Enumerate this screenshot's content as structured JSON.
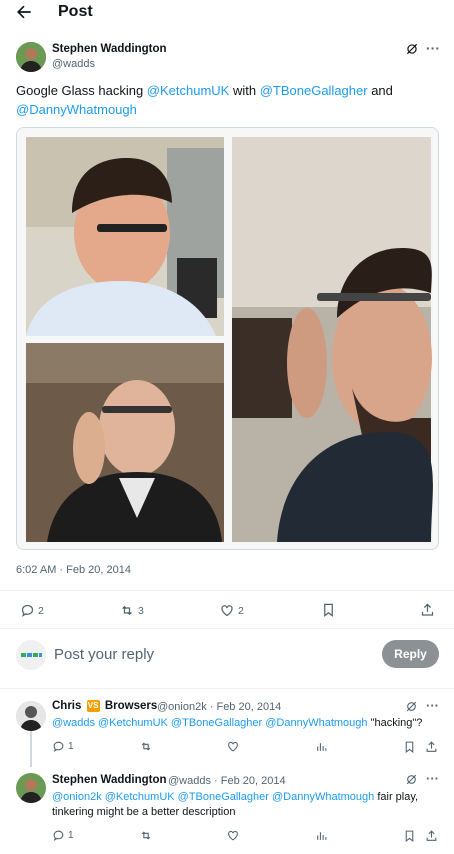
{
  "header": {
    "title": "Post",
    "back_icon": "arrow-left-icon"
  },
  "post": {
    "author_name": "Stephen Waddington",
    "author_handle": "@wadds",
    "text_before": "Google Glass hacking ",
    "mention_1": "@KetchumUK",
    "text_with": " with ",
    "mention_2": "@TBoneGallagher",
    "text_and": " and",
    "mention_3": "@DannyWhatmough",
    "timestamp": "6:02 AM · Feb 20, 2014",
    "replies": "2",
    "reposts": "3",
    "likes": "2"
  },
  "reply_box": {
    "placeholder": "Post your reply",
    "button_label": "Reply"
  },
  "replies": [
    {
      "name_part1": "Chris",
      "badge": "VS",
      "name_part2": "Browsers",
      "handle_date": "@onion2k · Feb 20, 2014",
      "mentions": "@wadds @KetchumUK @TBoneGallagher @DannyWhatmough",
      "text": " \"hacking\"?",
      "replies": "1"
    },
    {
      "name": "Stephen Waddington",
      "handle_date": "@wadds · Feb 20, 2014",
      "mentions": "@onion2k @KetchumUK @TBoneGallagher @DannyWhatmough",
      "text_line1": " fair play,",
      "text_line2": "tinkering might be a better description",
      "replies": "1"
    }
  ],
  "colors": {
    "link": "#1d9bf0",
    "muted": "#536471",
    "border": "#cfd9de",
    "reply_button": "#8c9196"
  }
}
